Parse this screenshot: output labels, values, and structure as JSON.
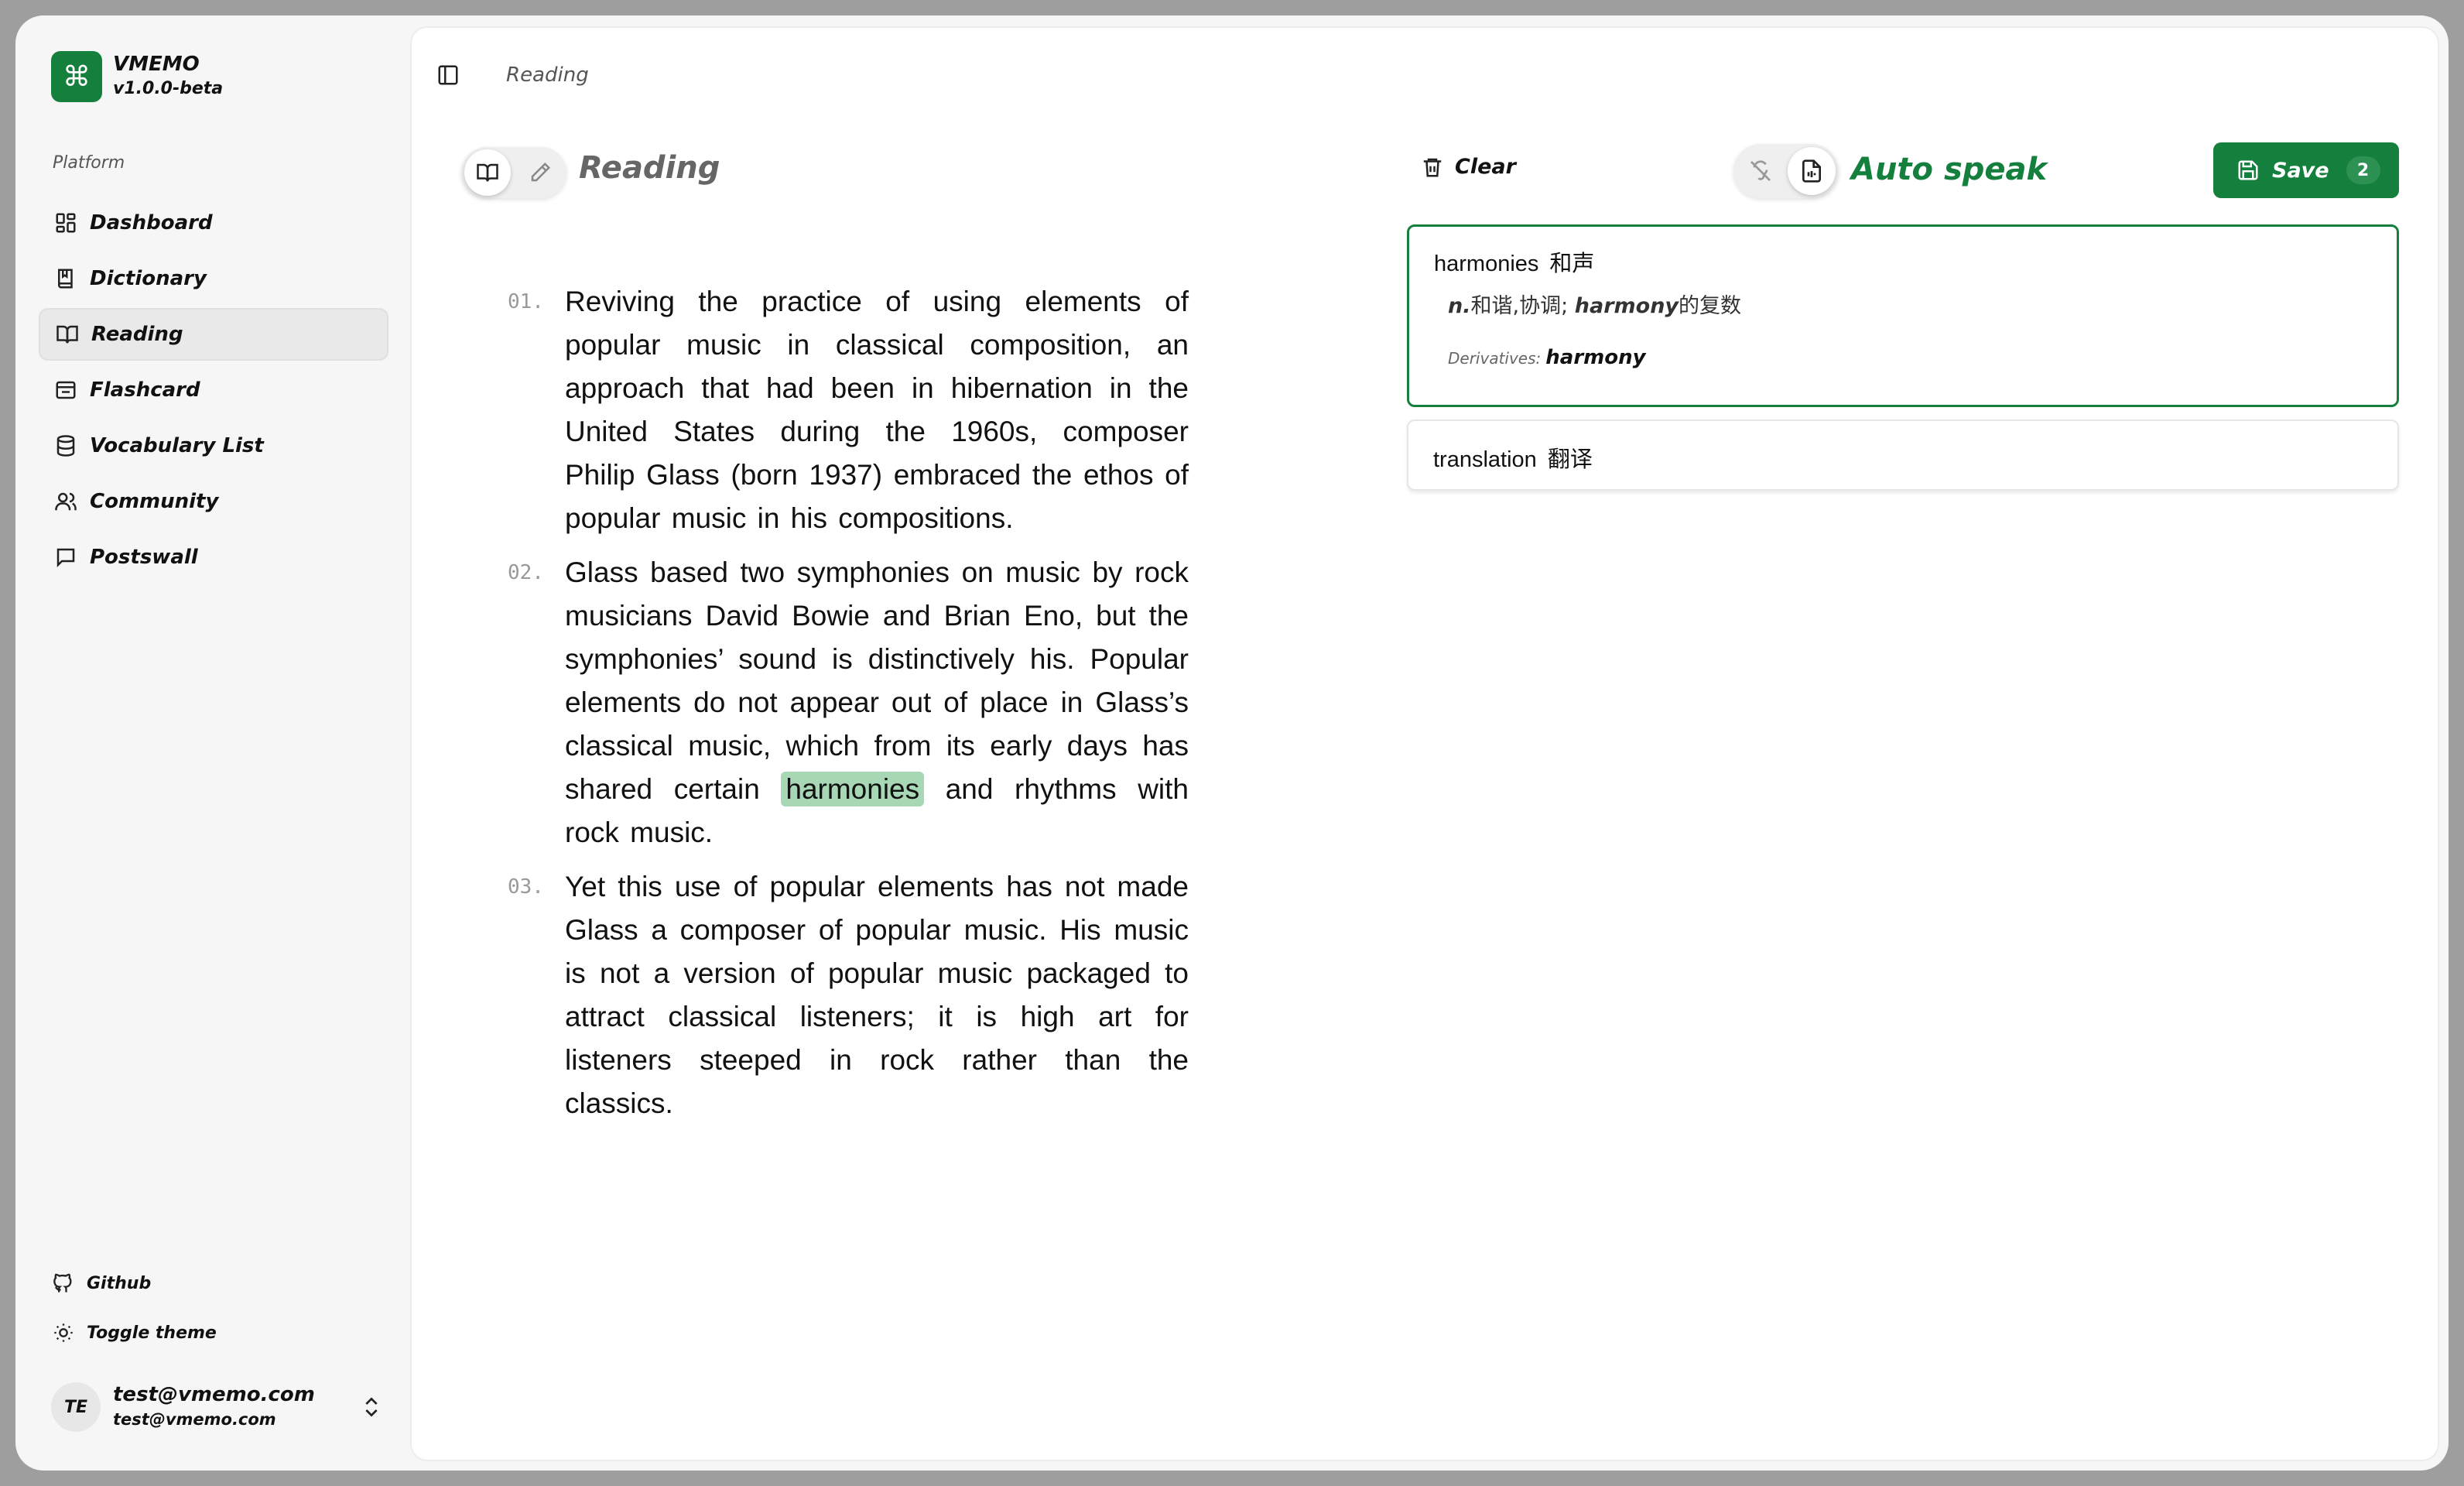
{
  "brand": {
    "logo_glyph": "⌘",
    "name": "VMEMO",
    "version": "v1.0.0-beta",
    "color": "#15803d"
  },
  "sidebar": {
    "section_label": "Platform",
    "items": [
      {
        "label": "Dashboard",
        "icon": "dashboard-icon"
      },
      {
        "label": "Dictionary",
        "icon": "book-icon"
      },
      {
        "label": "Reading",
        "icon": "open-book-icon",
        "active": true
      },
      {
        "label": "Flashcard",
        "icon": "flashcard-icon"
      },
      {
        "label": "Vocabulary List",
        "icon": "database-icon"
      },
      {
        "label": "Community",
        "icon": "users-icon"
      },
      {
        "label": "Postswall",
        "icon": "message-icon"
      }
    ],
    "bottom": [
      {
        "label": "Github",
        "icon": "github-icon"
      },
      {
        "label": "Toggle theme",
        "icon": "sun-icon"
      }
    ],
    "user": {
      "initials": "TE",
      "name": "test@vmemo.com",
      "email": "test@vmemo.com"
    }
  },
  "header": {
    "breadcrumb": "Reading"
  },
  "reading": {
    "title": "Reading",
    "paragraphs": [
      {
        "num": "01.",
        "text": "Reviving the practice of using elements of popular music in classical composition, an approach that had been in hibernation in the United States during the 1960s, composer Philip Glass (born 1937) embraced the ethos of popular music in his compositions."
      },
      {
        "num": "02.",
        "before": "Glass based two symphonies on music by rock musicians David Bowie and Brian Eno, but the symphonies’ sound is distinctively his. Popular elements do not appear out of place in Glass’s classical music, which from its early days has shared certain",
        "highlight": "harmonies",
        "after": "and rhythms with rock music."
      },
      {
        "num": "03.",
        "text": "Yet this use of popular elements has not made Glass a composer of popular music. His music is not a version of popular music packaged to attract classical listeners; it is high art for listeners steeped in rock rather than the classics."
      }
    ]
  },
  "toolbar": {
    "clear_label": "Clear",
    "auto_speak_label": "Auto speak",
    "save_label": "Save",
    "save_count": "2"
  },
  "words": [
    {
      "word": "harmonies",
      "zh": "和声",
      "pos": "n.",
      "definition_zh": "和谐,协调; ",
      "definition_em": "harmony",
      "definition_tail": "的复数",
      "derivatives_label": "Derivatives:",
      "derivatives": "harmony",
      "active": true
    },
    {
      "word": "translation",
      "zh": "翻译"
    }
  ]
}
